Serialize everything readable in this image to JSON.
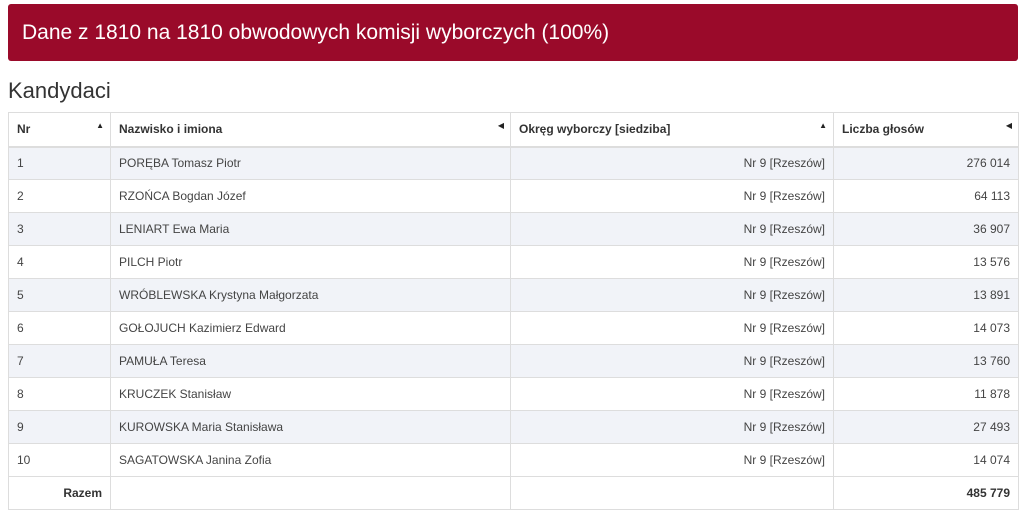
{
  "banner": {
    "text": "Dane z 1810 na 1810 obwodowych komisji wyborczych (100%)"
  },
  "section": {
    "title": "Kandydaci"
  },
  "table": {
    "headers": {
      "nr": "Nr",
      "name": "Nazwisko i imiona",
      "district": "Okręg wyborczy [siedziba]",
      "votes": "Liczba głosów"
    },
    "rows": [
      {
        "nr": "1",
        "name": "PORĘBA Tomasz Piotr",
        "district": "Nr 9 [Rzeszów]",
        "votes": "276 014"
      },
      {
        "nr": "2",
        "name": "RZOŃCA Bogdan Józef",
        "district": "Nr 9 [Rzeszów]",
        "votes": "64 113"
      },
      {
        "nr": "3",
        "name": "LENIART Ewa Maria",
        "district": "Nr 9 [Rzeszów]",
        "votes": "36 907"
      },
      {
        "nr": "4",
        "name": "PILCH Piotr",
        "district": "Nr 9 [Rzeszów]",
        "votes": "13 576"
      },
      {
        "nr": "5",
        "name": "WRÓBLEWSKA Krystyna Małgorzata",
        "district": "Nr 9 [Rzeszów]",
        "votes": "13 891"
      },
      {
        "nr": "6",
        "name": "GOŁOJUCH Kazimierz Edward",
        "district": "Nr 9 [Rzeszów]",
        "votes": "14 073"
      },
      {
        "nr": "7",
        "name": "PAMUŁA Teresa",
        "district": "Nr 9 [Rzeszów]",
        "votes": "13 760"
      },
      {
        "nr": "8",
        "name": "KRUCZEK Stanisław",
        "district": "Nr 9 [Rzeszów]",
        "votes": "11 878"
      },
      {
        "nr": "9",
        "name": "KUROWSKA Maria Stanisława",
        "district": "Nr 9 [Rzeszów]",
        "votes": "27 493"
      },
      {
        "nr": "10",
        "name": "SAGATOWSKA Janina Zofia",
        "district": "Nr 9 [Rzeszów]",
        "votes": "14 074"
      }
    ],
    "footer": {
      "label": "Razem",
      "total": "485 779"
    }
  },
  "icons": {
    "sort_asc": "sort-ascending-icon",
    "sort_none": "sort-left-icon"
  },
  "colors": {
    "banner_bg": "#9a0a2a",
    "odd_row_bg": "#f1f3f8"
  }
}
